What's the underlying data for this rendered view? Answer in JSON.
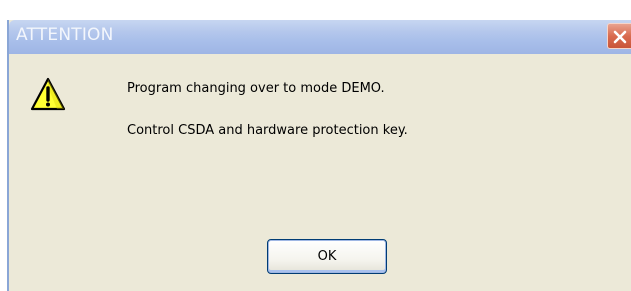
{
  "dialog": {
    "title": "ATTENTION",
    "icon": "warning-icon",
    "close_icon": "close-icon",
    "messages": [
      "Program changing over to mode DEMO.",
      "Control CSDA and hardware protection key."
    ],
    "ok_label": "OK"
  },
  "colors": {
    "titlebar": "#a9bfea",
    "dialog_background": "#ece9d8",
    "close_button": "#d96b4f",
    "warning_fill": "#ffff00"
  }
}
